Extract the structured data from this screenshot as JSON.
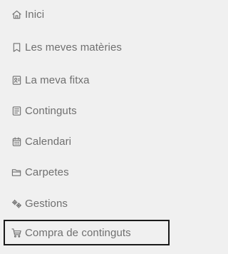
{
  "menu": {
    "items": [
      {
        "label": "Inici",
        "icon": "home-icon"
      },
      {
        "label": "Les meves matèries",
        "icon": "bookmark-icon"
      },
      {
        "label": "La meva fitxa",
        "icon": "profile-card-icon"
      },
      {
        "label": "Continguts",
        "icon": "document-icon"
      },
      {
        "label": "Calendari",
        "icon": "calendar-icon"
      },
      {
        "label": "Carpetes",
        "icon": "folder-icon"
      },
      {
        "label": "Gestions",
        "icon": "gears-icon"
      },
      {
        "label": "Compra de continguts",
        "icon": "cart-icon",
        "active": true
      }
    ]
  },
  "colors": {
    "background": "#f0f0f0",
    "text": "#6f6f6f",
    "active_border": "#1a1a1a"
  }
}
